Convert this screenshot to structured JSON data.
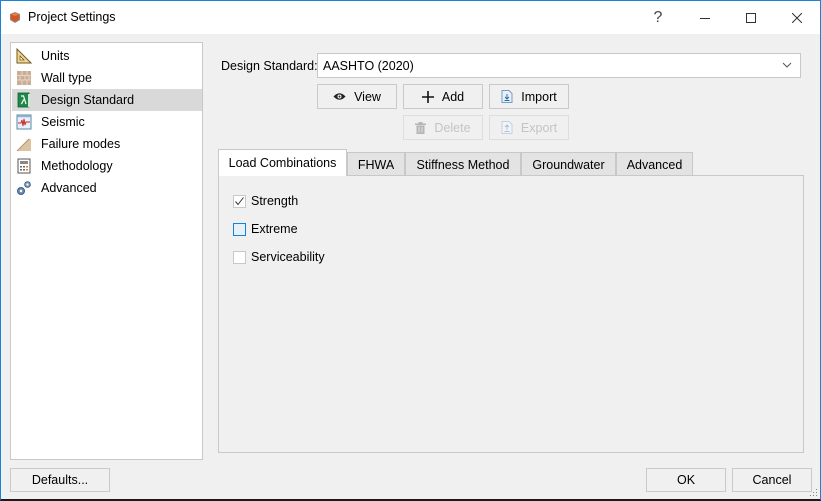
{
  "window": {
    "title": "Project Settings",
    "help_label": "?"
  },
  "sidebar": {
    "items": [
      {
        "label": "Units",
        "icon": "triangle-ruler-icon",
        "selected": false
      },
      {
        "label": "Wall type",
        "icon": "brick-wall-icon",
        "selected": false
      },
      {
        "label": "Design Standard",
        "icon": "lambda-book-icon",
        "selected": true
      },
      {
        "label": "Seismic",
        "icon": "seismograph-icon",
        "selected": false
      },
      {
        "label": "Failure modes",
        "icon": "slope-icon",
        "selected": false
      },
      {
        "label": "Methodology",
        "icon": "calculator-icon",
        "selected": false
      },
      {
        "label": "Advanced",
        "icon": "gears-icon",
        "selected": false
      }
    ]
  },
  "design_standard": {
    "label": "Design Standard:",
    "value": "AASHTO (2020)"
  },
  "actions": {
    "view": "View",
    "add": "Add",
    "import": "Import",
    "delete": "Delete",
    "export": "Export"
  },
  "tabs": [
    {
      "label": "Load Combinations",
      "active": true
    },
    {
      "label": "FHWA",
      "active": false
    },
    {
      "label": "Stiffness Method",
      "active": false
    },
    {
      "label": "Groundwater",
      "active": false
    },
    {
      "label": "Advanced",
      "active": false
    }
  ],
  "load_combinations": [
    {
      "label": "Strength",
      "checked": true
    },
    {
      "label": "Extreme",
      "checked": false
    },
    {
      "label": "Serviceability",
      "checked": false
    }
  ],
  "footer": {
    "defaults": "Defaults...",
    "ok": "OK",
    "cancel": "Cancel"
  },
  "colors": {
    "accent": "#1883d7",
    "selected_row": "#d9d9d9",
    "disabled_text": "#c4c4c4"
  }
}
